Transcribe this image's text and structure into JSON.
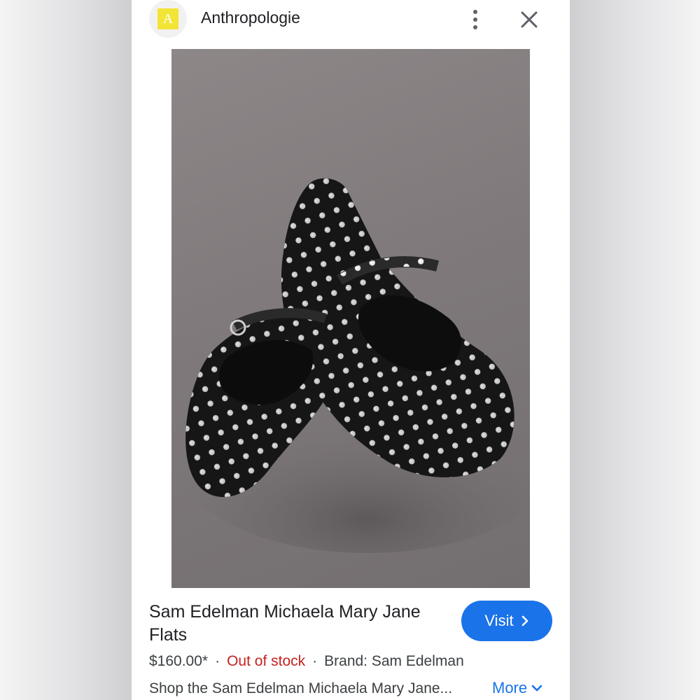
{
  "header": {
    "site_badge": "A",
    "site_name": "Anthropologie"
  },
  "product": {
    "title": "Sam Edelman Michaela Mary Jane Flats",
    "price": "$160.00*",
    "separator": "·",
    "stock_status": "Out of stock",
    "brand": "Brand: Sam Edelman",
    "description": "Shop the Sam Edelman Michaela Mary Jane...",
    "visit_label": "Visit",
    "more_label": "More"
  },
  "colors": {
    "accent": "#1a73e8",
    "out_of_stock": "#c5221f",
    "badge": "#f2e535"
  },
  "icons": {
    "more": "vertical-dots-icon",
    "close": "close-icon",
    "visit": "chevron-right-icon",
    "more_link": "chevron-down-icon"
  }
}
